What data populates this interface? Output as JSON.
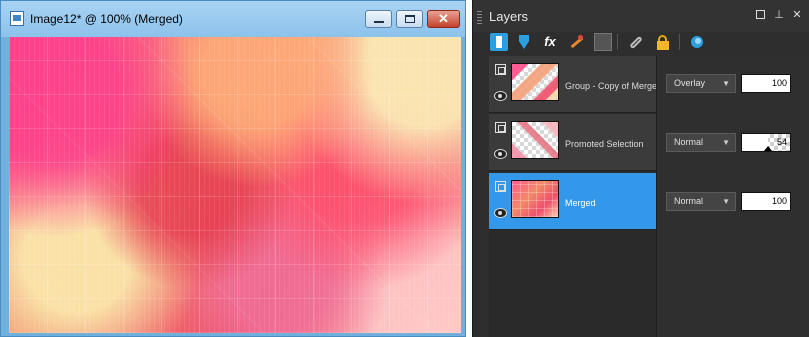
{
  "image_window": {
    "title": "Image12* @ 100% (Merged)",
    "controls": {
      "minimize": "minimize",
      "maximize": "maximize",
      "close": "✕"
    }
  },
  "layers_palette": {
    "title": "Layers",
    "header_buttons": [
      "restore-square",
      "pin",
      "close"
    ],
    "toolbar_icons": [
      "new-raster-layer-icon",
      "new-mask-layer-icon",
      "layer-effects-icon",
      "edit-selection-icon",
      "delete-layer-icon",
      "link-layers-icon",
      "lock-transparency-icon",
      "layer-style-icon"
    ],
    "layers": [
      {
        "name": "Group - Copy of Merge",
        "blend_mode": "Overlay",
        "opacity": "100",
        "opacity_level": 1.0,
        "selected": false
      },
      {
        "name": "Promoted Selection",
        "blend_mode": "Normal",
        "opacity": "54",
        "opacity_level": 0.54,
        "selected": false
      },
      {
        "name": "Merged",
        "blend_mode": "Normal",
        "opacity": "100",
        "opacity_level": 1.0,
        "selected": true
      }
    ]
  },
  "colors": {
    "title_bar": "#99c8ef",
    "close_button": "#c9452f",
    "palette_background": "#2e2e2e",
    "selected_layer": "#3398ea"
  }
}
